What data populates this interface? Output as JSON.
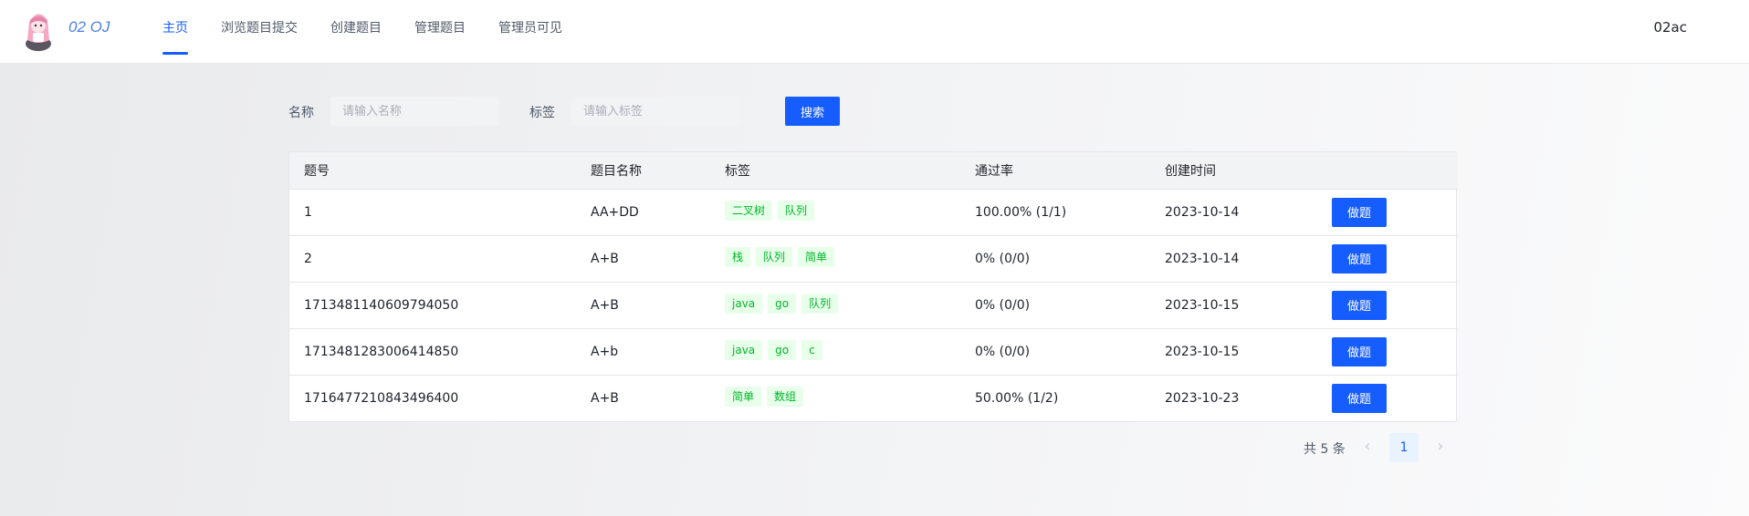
{
  "header": {
    "logo_text": "02 OJ",
    "nav": [
      {
        "label": "主页",
        "active": true
      },
      {
        "label": "浏览题目提交",
        "active": false
      },
      {
        "label": "创建题目",
        "active": false
      },
      {
        "label": "管理题目",
        "active": false
      },
      {
        "label": "管理员可见",
        "active": false
      }
    ],
    "user": "02ac"
  },
  "search": {
    "name_label": "名称",
    "name_placeholder": "请输入名称",
    "tag_label": "标签",
    "tag_placeholder": "请输入标签",
    "button": "搜索"
  },
  "table": {
    "columns": [
      "题号",
      "题目名称",
      "标签",
      "通过率",
      "创建时间",
      ""
    ],
    "action_label": "做题",
    "rows": [
      {
        "id": "1",
        "name": "AA+DD",
        "tags": [
          "二叉树",
          "队列"
        ],
        "rate": "100.00% (1/1)",
        "created": "2023-10-14"
      },
      {
        "id": "2",
        "name": "A+B",
        "tags": [
          "栈",
          "队列",
          "简单"
        ],
        "rate": "0% (0/0)",
        "created": "2023-10-14"
      },
      {
        "id": "1713481140609794050",
        "name": "A+B",
        "tags": [
          "java",
          "go",
          "队列"
        ],
        "rate": "0% (0/0)",
        "created": "2023-10-15"
      },
      {
        "id": "1713481283006414850",
        "name": "A+b",
        "tags": [
          "java",
          "go",
          "c"
        ],
        "rate": "0% (0/0)",
        "created": "2023-10-15"
      },
      {
        "id": "1716477210843496400",
        "name": "A+B",
        "tags": [
          "简单",
          "数组"
        ],
        "rate": "50.00% (1/2)",
        "created": "2023-10-23"
      }
    ]
  },
  "pagination": {
    "total_text": "共 5 条",
    "current_page": "1",
    "prev_icon": "chevron-left-icon",
    "next_icon": "chevron-right-icon"
  },
  "colors": {
    "primary": "#165dff",
    "tag_bg": "#e8ffea",
    "tag_text": "#00b42a"
  }
}
